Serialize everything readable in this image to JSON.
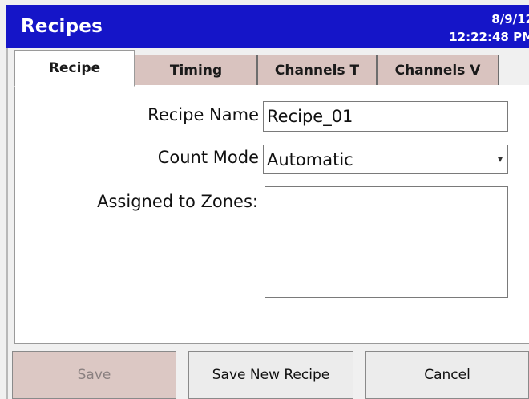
{
  "window": {
    "title": "Recipes",
    "date": "8/9/12",
    "time": "12:22:48 PM"
  },
  "tabs": [
    {
      "label": "Recipe",
      "active": true
    },
    {
      "label": "Timing",
      "active": false
    },
    {
      "label": "Channels T",
      "active": false
    },
    {
      "label": "Channels V",
      "active": false
    }
  ],
  "form": {
    "recipe_name_label": "Recipe Name",
    "recipe_name_value": "Recipe_01",
    "count_mode_label": "Count Mode",
    "count_mode_value": "Automatic",
    "assigned_zones_label": "Assigned to Zones:"
  },
  "buttons": {
    "save": "Save",
    "save_new": "Save New Recipe",
    "cancel": "Cancel"
  },
  "colors": {
    "titlebar": "#1515c8",
    "tab_inactive": "#d9c3bf",
    "button_disabled": "#dcc8c4"
  }
}
